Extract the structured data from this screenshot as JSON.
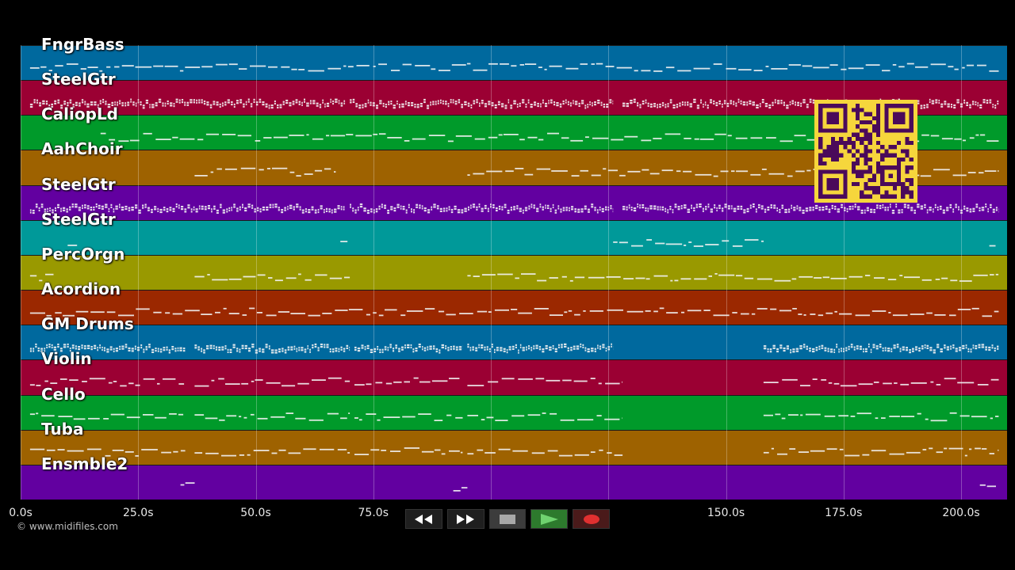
{
  "tracks": [
    {
      "name": "FngrBass",
      "color": "#00699e"
    },
    {
      "name": "SteelGtr",
      "color": "#9b0033"
    },
    {
      "name": "CaliopLd",
      "color": "#009a2a"
    },
    {
      "name": "AahChoir",
      "color": "#9e6200"
    },
    {
      "name": "SteelGtr",
      "color": "#6200a0"
    },
    {
      "name": "SteelGtr",
      "color": "#009999"
    },
    {
      "name": "PercOrgn",
      "color": "#999900"
    },
    {
      "name": "Acordion",
      "color": "#9b2800"
    },
    {
      "name": "GM Drums",
      "color": "#00699e"
    },
    {
      "name": "Violin",
      "color": "#9b0033"
    },
    {
      "name": "Cello",
      "color": "#009a2a"
    },
    {
      "name": "Tuba",
      "color": "#9e6200"
    },
    {
      "name": "Ensmble2",
      "color": "#6200a0"
    }
  ],
  "timeline": {
    "max_seconds": 210,
    "ticks": [
      "0.0s",
      "25.0s",
      "50.0s",
      "75.0s",
      "",
      "",
      "150.0s",
      "175.0s",
      "200.0s"
    ],
    "tick_values": [
      0,
      25,
      50,
      75,
      100,
      125,
      150,
      175,
      200
    ]
  },
  "copyright": "© www.midifiles.com",
  "transport": {
    "rewind_icon": "rewind-icon",
    "forward_icon": "fast-forward-icon",
    "stop_icon": "stop-icon",
    "play_icon": "play-icon",
    "record_icon": "record-icon",
    "play_color": "#6fd36f",
    "record_color": "#e03030"
  },
  "qr": {
    "color_fg": "#4a0a5a",
    "color_bg": "#f6d63c",
    "icon": "qr-code-icon"
  }
}
